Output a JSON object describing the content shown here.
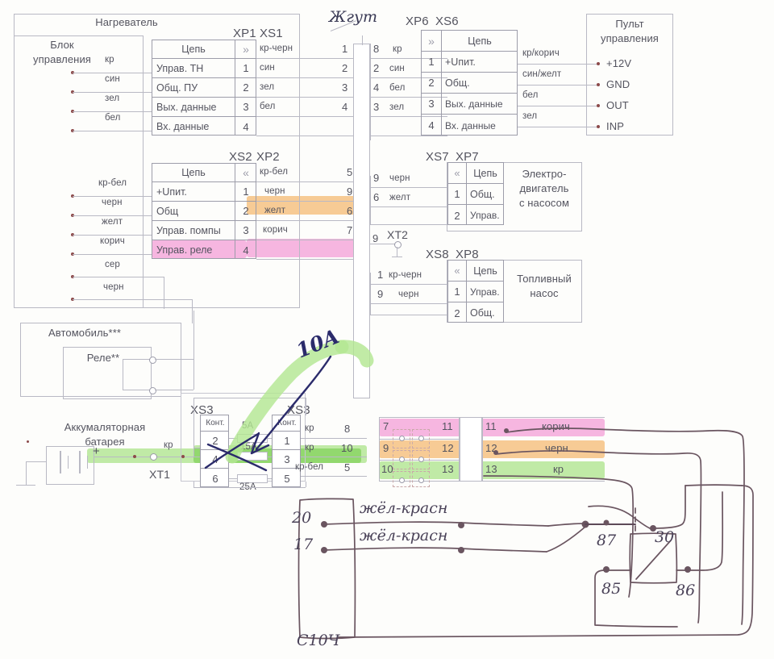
{
  "diagram": {
    "title_heater": "Нагреватель",
    "title_control_unit": "Блок управления",
    "title_harness": "Жгут",
    "title_control_panel": "Пульт управления",
    "title_motor_pump": "Электро-двигатель с насосом",
    "title_fuel_pump": "Топливный насос",
    "title_car": "Автомобиль***",
    "title_relay": "Реле**",
    "title_battery": "Аккумаляторная батарея",
    "circuit_header": "Цепь",
    "contact_header": "Конт."
  },
  "connectors": {
    "xp1_xs1": {
      "left_label": "XP1",
      "right_label": "XS1",
      "arrow": "»",
      "rows": [
        {
          "unit_wire": "кр",
          "circuit": "Управ. ТН",
          "pin": "1",
          "harness_wire": "кр-черн",
          "harness_pin": "1"
        },
        {
          "unit_wire": "син",
          "circuit": "Общ. ПУ",
          "pin": "2",
          "harness_wire": "син",
          "harness_pin": "2"
        },
        {
          "unit_wire": "зел",
          "circuit": "Вых. данные",
          "pin": "3",
          "harness_wire": "зел",
          "harness_pin": "3"
        },
        {
          "unit_wire": "бел",
          "circuit": "Вх. данные",
          "pin": "4",
          "harness_wire": "бел",
          "harness_pin": "4"
        }
      ]
    },
    "xs2_xp2": {
      "left_label": "XS2",
      "right_label": "XP2",
      "arrow": "«",
      "rows": [
        {
          "unit_wire": "кр-бел",
          "circuit": "+Uпит.",
          "pin": "1",
          "harness_wire": "кр-бел",
          "harness_pin": "5",
          "highlight": ""
        },
        {
          "unit_wire": "черн",
          "circuit": "Общ",
          "pin": "2",
          "harness_wire": "черн",
          "harness_pin": "9",
          "highlight": "orange"
        },
        {
          "unit_wire": "желт",
          "circuit": "Управ. помпы",
          "pin": "3",
          "harness_wire": "желт",
          "harness_pin": "6",
          "highlight": ""
        },
        {
          "unit_wire": "корич",
          "circuit": "Управ. реле",
          "pin": "4",
          "harness_wire": "корич",
          "harness_pin": "7",
          "highlight": "pink"
        }
      ],
      "extra_wires": [
        "сер",
        "черн"
      ]
    },
    "xp6_xs6": {
      "left_label": "XP6",
      "right_label": "XS6",
      "arrow": "»",
      "rows": [
        {
          "harness_pin": "8",
          "harness_wire": "кр",
          "pin": "1",
          "circuit": "+Uпит.",
          "panel_wire": "кр/корич",
          "panel_term": "+12V"
        },
        {
          "harness_pin": "2",
          "harness_wire": "син",
          "pin": "2",
          "circuit": "Общ.",
          "panel_wire": "син/желт",
          "panel_term": "GND"
        },
        {
          "harness_pin": "4",
          "harness_wire": "бел",
          "pin": "3",
          "circuit": "Вых. данные",
          "panel_wire": "бел",
          "panel_term": "OUT"
        },
        {
          "harness_pin": "3",
          "harness_wire": "зел",
          "pin": "4",
          "circuit": "Вх. данные",
          "panel_wire": "зел",
          "panel_term": "INP"
        }
      ]
    },
    "xs7_xp7": {
      "left_label": "XS7",
      "right_label": "XP7",
      "arrow": "«",
      "rows": [
        {
          "harness_pin": "9",
          "harness_wire": "черн",
          "pin": "1",
          "circuit": "Общ."
        },
        {
          "harness_pin": "6",
          "harness_wire": "желт",
          "pin": "2",
          "circuit": "Управ."
        }
      ]
    },
    "xs8_xp8": {
      "left_label": "XS8",
      "right_label": "XP8",
      "arrow": "«",
      "rows": [
        {
          "harness_pin": "1",
          "harness_wire": "кр-черн",
          "pin": "1",
          "circuit": "Управ."
        },
        {
          "harness_pin": "9",
          "harness_wire": "черн",
          "pin": "2",
          "circuit": "Общ."
        }
      ]
    },
    "xt2": {
      "label": "XT2",
      "harness_pin": "9"
    },
    "xt1": {
      "label": "XT1",
      "wire": "кр"
    },
    "xs3_left": {
      "label": "XS3",
      "header": "Конт.",
      "pins": [
        "2",
        "4",
        "6"
      ]
    },
    "xs3_right": {
      "label": "XS3",
      "header": "Конт.",
      "rows": [
        {
          "pin": "1",
          "wire": "кр",
          "harness_pin": "8"
        },
        {
          "pin": "3",
          "wire": "кр",
          "harness_pin": "10"
        },
        {
          "pin": "5",
          "wire": "кр-бел",
          "harness_pin": "5"
        }
      ]
    },
    "fuses": [
      {
        "rating": "5A",
        "crossed": false
      },
      {
        "rating": "15A",
        "crossed": true
      },
      {
        "rating": "25A",
        "crossed": false
      }
    ],
    "power_block": {
      "rows": [
        {
          "left_pin": "7",
          "mid_pin": "11",
          "right_pin": "11",
          "wire": "корич",
          "highlight": "pink"
        },
        {
          "left_pin": "9",
          "mid_pin": "12",
          "right_pin": "12",
          "wire": "черн",
          "highlight": "orange"
        },
        {
          "left_pin": "10",
          "mid_pin": "13",
          "right_pin": "13",
          "wire": "кр",
          "highlight": "green"
        }
      ]
    }
  },
  "control_panel_terminals": [
    "+12V",
    "GND",
    "OUT",
    "INP"
  ],
  "handwritten": {
    "fuse_note": "10A",
    "connector_name": "С10Ч",
    "pin_20": "20",
    "pin_17": "17",
    "wire_20": "жёл-красн",
    "wire_17": "жёл-красн",
    "relay_87": "87",
    "relay_30": "30",
    "relay_85": "85",
    "relay_86": "86"
  },
  "colors": {
    "highlight_pink": "#f6a6de",
    "highlight_orange": "#f8c585",
    "highlight_green": "#b3e793",
    "ink_blue": "#2b2b6b",
    "pencil": "#6a5560",
    "print_line": "#9d9daa",
    "print_text": "#54545f"
  }
}
